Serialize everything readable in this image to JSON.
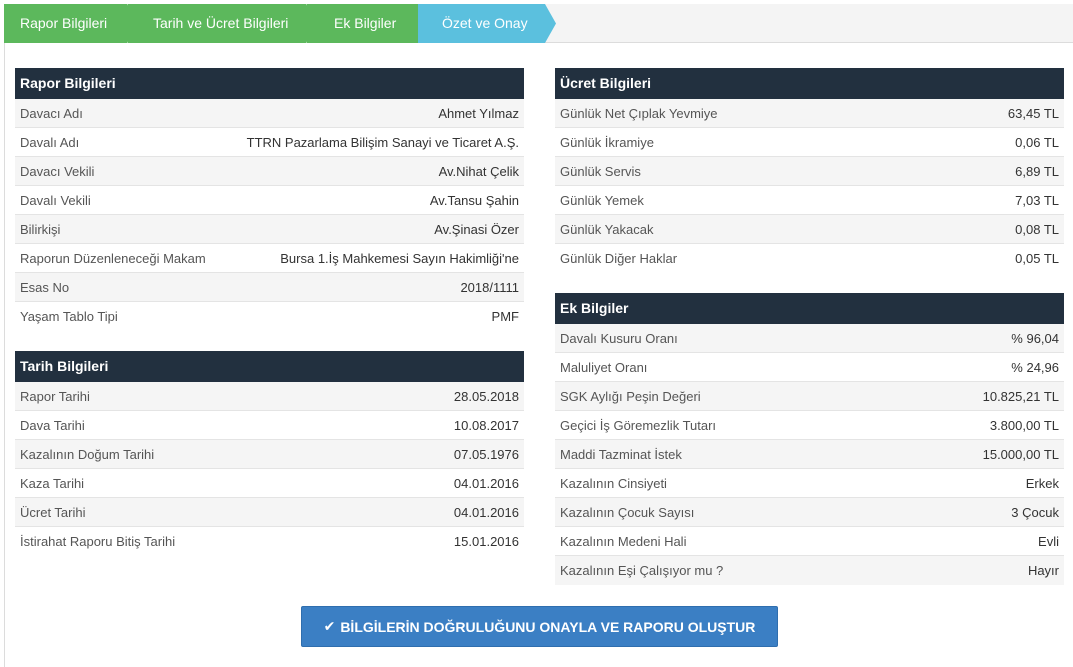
{
  "wizard": {
    "steps": [
      {
        "label": "Rapor Bilgileri",
        "color": "#5cb85c"
      },
      {
        "label": "Tarih ve Ücret Bilgileri",
        "color": "#5cb85c"
      },
      {
        "label": "Ek Bilgiler",
        "color": "#5cb85c"
      },
      {
        "label": "Özet ve Onay",
        "color": "#5bc0de"
      }
    ]
  },
  "rapor": {
    "title": "Rapor Bilgileri",
    "rows": [
      {
        "k": "Davacı Adı",
        "v": "Ahmet Yılmaz"
      },
      {
        "k": "Davalı Adı",
        "v": "TTRN Pazarlama Bilişim Sanayi ve Ticaret A.Ş."
      },
      {
        "k": "Davacı Vekili",
        "v": "Av.Nihat Çelik"
      },
      {
        "k": "Davalı Vekili",
        "v": "Av.Tansu Şahin"
      },
      {
        "k": "Bilirkişi",
        "v": "Av.Şinasi Özer"
      },
      {
        "k": "Raporun Düzenleneceği Makam",
        "v": "Bursa 1.İş Mahkemesi Sayın Hakimliği'ne"
      },
      {
        "k": "Esas No",
        "v": "2018/1111"
      },
      {
        "k": "Yaşam Tablo Tipi",
        "v": "PMF"
      }
    ]
  },
  "tarih": {
    "title": "Tarih Bilgileri",
    "rows": [
      {
        "k": "Rapor Tarihi",
        "v": "28.05.2018"
      },
      {
        "k": "Dava Tarihi",
        "v": "10.08.2017"
      },
      {
        "k": "Kazalının Doğum Tarihi",
        "v": "07.05.1976"
      },
      {
        "k": "Kaza Tarihi",
        "v": "04.01.2016"
      },
      {
        "k": "Ücret Tarihi",
        "v": "04.01.2016"
      },
      {
        "k": "İstirahat Raporu Bitiş Tarihi",
        "v": "15.01.2016"
      }
    ]
  },
  "ucret": {
    "title": "Ücret Bilgileri",
    "rows": [
      {
        "k": "Günlük Net Çıplak Yevmiye",
        "v": "63,45 TL"
      },
      {
        "k": "Günlük İkramiye",
        "v": "0,06 TL"
      },
      {
        "k": "Günlük Servis",
        "v": "6,89 TL"
      },
      {
        "k": "Günlük Yemek",
        "v": "7,03 TL"
      },
      {
        "k": "Günlük Yakacak",
        "v": "0,08 TL"
      },
      {
        "k": "Günlük Diğer Haklar",
        "v": "0,05 TL"
      }
    ]
  },
  "ek": {
    "title": "Ek Bilgiler",
    "rows": [
      {
        "k": "Davalı Kusuru Oranı",
        "v": "% 96,04"
      },
      {
        "k": "Maluliyet Oranı",
        "v": "% 24,96"
      },
      {
        "k": "SGK Aylığı Peşin Değeri",
        "v": "10.825,21 TL"
      },
      {
        "k": "Geçici İş Göremezlik Tutarı",
        "v": "3.800,00 TL"
      },
      {
        "k": "Maddi Tazminat İstek",
        "v": "15.000,00 TL"
      },
      {
        "k": "Kazalının Cinsiyeti",
        "v": "Erkek"
      },
      {
        "k": "Kazalının Çocuk Sayısı",
        "v": "3 Çocuk"
      },
      {
        "k": "Kazalının Medeni Hali",
        "v": "Evli"
      },
      {
        "k": "Kazalının Eşi Çalışıyor mu ?",
        "v": "Hayır"
      }
    ]
  },
  "confirm_button": {
    "label": "BİLGİLERİN DOĞRULUĞUNU ONAYLA VE RAPORU OLUŞTUR",
    "icon": "check-icon"
  }
}
